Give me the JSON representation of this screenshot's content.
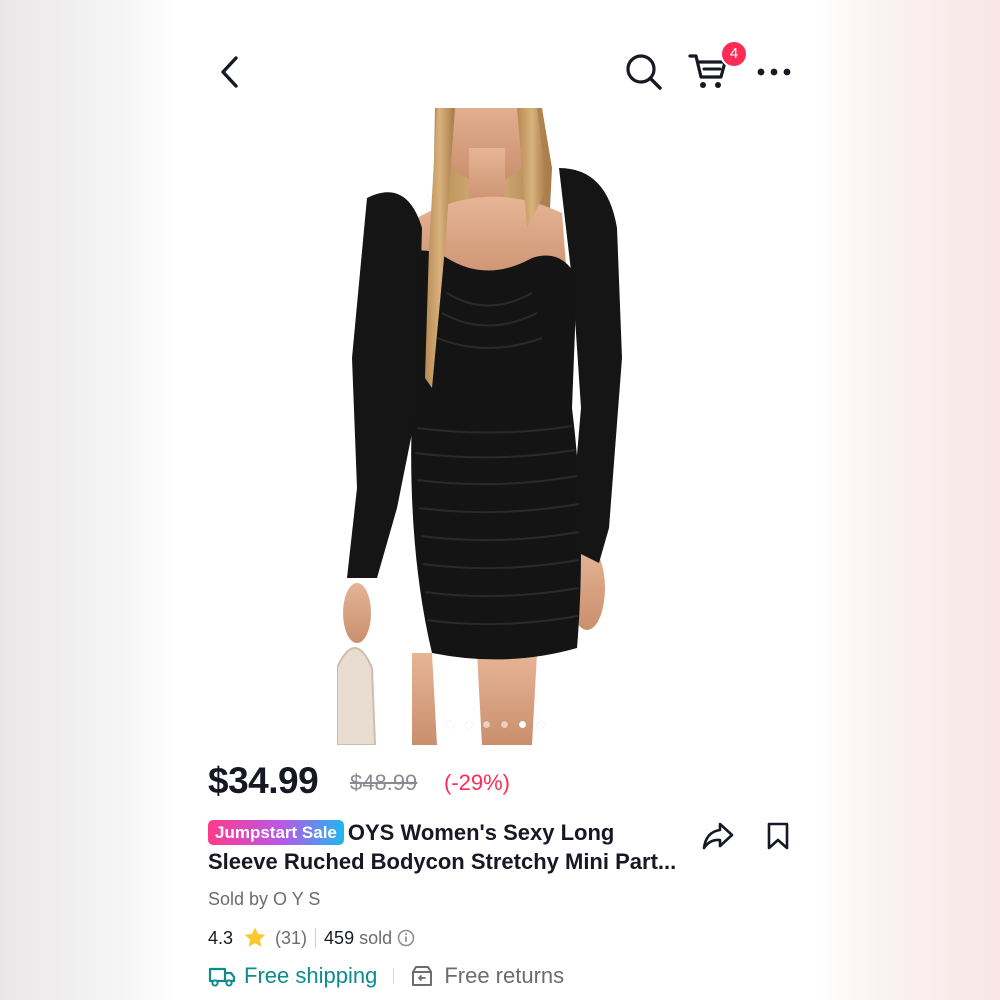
{
  "header": {
    "back_icon": "chevron-left-icon",
    "search_icon": "search-icon",
    "cart_icon": "cart-icon",
    "cart_count": "4",
    "more_icon": "more-horizontal-icon"
  },
  "gallery": {
    "image": "product-photo-black-ruched-bodycon-mini-dress",
    "dot_count": 6,
    "active_dot": 5
  },
  "price": {
    "current": "$34.99",
    "original": "$48.99",
    "discount": "(-29%)"
  },
  "product": {
    "badge": "Jumpstart Sale",
    "title": "OYS Women's Sexy Long Sleeve Ruched Bodycon Stretchy Mini Part...",
    "seller": "Sold by O Y S"
  },
  "rating": {
    "score": "4.3",
    "reviews": "(31)",
    "sold_count": "459",
    "sold_label": "sold"
  },
  "shipping": {
    "free_shipping": "Free shipping",
    "free_returns": "Free returns"
  },
  "colors": {
    "accent": "#fe2c55",
    "teal": "#0e8b8d",
    "text": "#161823",
    "muted": "#6b6c72",
    "star": "#fcc82f"
  }
}
